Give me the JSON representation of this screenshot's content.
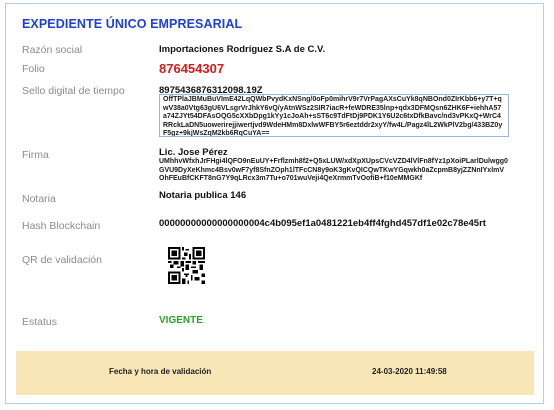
{
  "title": "EXPEDIENTE ÚNICO EMPRESARIAL",
  "fields": {
    "razon_social": {
      "label": "Razón social",
      "value": "Importaciones Rodríguez S.A de C.V."
    },
    "folio": {
      "label": "Folio",
      "value": "876454307"
    },
    "sello": {
      "label": "Sello digital de tiempo",
      "value": "8975436876312098.19Z",
      "digest": "OffTPlaJBMuBuVImE42LqQWbPvydKxNSng/0oFp0mihrV9r7VrPagAXsCuYk8qNBOnd0ZIrKbb6+y7T+qwV38a0Vtg63gU6VLsgrVrJhkY6vQ/yAtnWSz2SIR7iacR+feWDRE35lnp+qdx3DFMQsn6ZHK6F+iehhA57a74ZJYt54DFAsOQG5cXXbDpg1kYy1cJoAh+sST6c9TdFtDj9PDK1Y6U2c6txDfkBavc/nd3vPKxQ+WrC4RRckLaDN5uowerirejjiwertjvd9WdeHMm8DxlwWFBY5r6eztddr2xyY/fw4L/Pagz4lL2WkPlV2bg/433BZ0yF5gz+9kjWsZqM2kb6RqCuYA=="
    },
    "firma": {
      "label": "Firma",
      "value": "Lic. Jose Pérez",
      "digest": "UMhhvWfxhJrFHgi4lQFO9nEuUY+Frflzmh8f2+Q5xLUW/xdXpXUpsCVcVZD4lVlFn8fYz1pXoiPLarlDulwgg0GVU9DyXeKhmc4Bsv0wF7yf8SfnZOph1lTFcCN8y9oK3gKvQICQwTKwYGqwkh0aZcpmB8yjZZNnIYxlmVOhFEuBfCKFT8nG7Y9qLRcx3m7Tu+o701wuVeji4QeXrmmTvOofiB+f10eMMGKf"
    },
    "notaria": {
      "label": "Notaria",
      "value": "Notaria publica 146"
    },
    "hash": {
      "label": "Hash Blockchain",
      "value": "00000000000000000004c4b095ef1a0481221eb4ff4fghd457df1e02c78e45rt"
    },
    "qr": {
      "label": "QR de validación"
    },
    "estatus": {
      "label": "Estatus",
      "value": "VIGENTE"
    }
  },
  "footer": {
    "label": "Fecha y hora de validación",
    "value": "24-03-2020 11:49:58"
  },
  "colors": {
    "title": "#1e40d6",
    "folio": "#d41c1c",
    "status": "#2aa42a",
    "footer_bg": "#f8e6b6",
    "border": "#b9cde3"
  },
  "icons": {
    "qr": "qr-code-icon"
  }
}
